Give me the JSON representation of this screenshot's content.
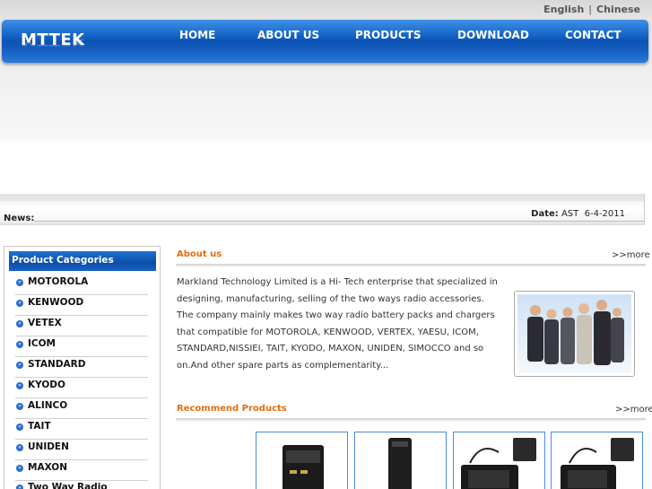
{
  "header": {
    "lang": {
      "english": "English",
      "separator": "|",
      "chinese": "Chinese"
    },
    "logo": "MTTEK",
    "nav": [
      "HOME",
      "ABOUT US",
      "PRODUCTS",
      "DOWNLOAD",
      "CONTACT"
    ]
  },
  "news": {
    "label": "News:",
    "date_label": "Date:",
    "date_value": "AST  6-4-2011"
  },
  "sidebar": {
    "title": "Product Categories",
    "items": [
      "MOTOROLA",
      "KENWOOD",
      "VETEX",
      "ICOM",
      "STANDARD",
      "KYODO",
      "ALINCO",
      "TAIT",
      "UNIDEN",
      "MAXON",
      "Two Way Radio"
    ]
  },
  "about": {
    "title": "About us",
    "more": ">>more",
    "text": "Markland Technology Limited is a Hi- Tech enterprise that specialized in designing, manufacturing, selling of the two ways radio accessories. The company mainly makes two way radio battery packs and chargers that compatible for MOTOROLA, KENWOOD, VERTEX, YAESU, ICOM, STANDARD,NISSIEI, TAIT, KYODO, MAXON, UNIDEN, SIMOCCO and so on.And other spare parts as complementarity..."
  },
  "recommend": {
    "title": "Recommend Products",
    "more": ">>more"
  },
  "colors": {
    "nav_blue": "#0b52b4",
    "accent_orange": "#e46d10",
    "category_blue": "#1f6fd1"
  }
}
